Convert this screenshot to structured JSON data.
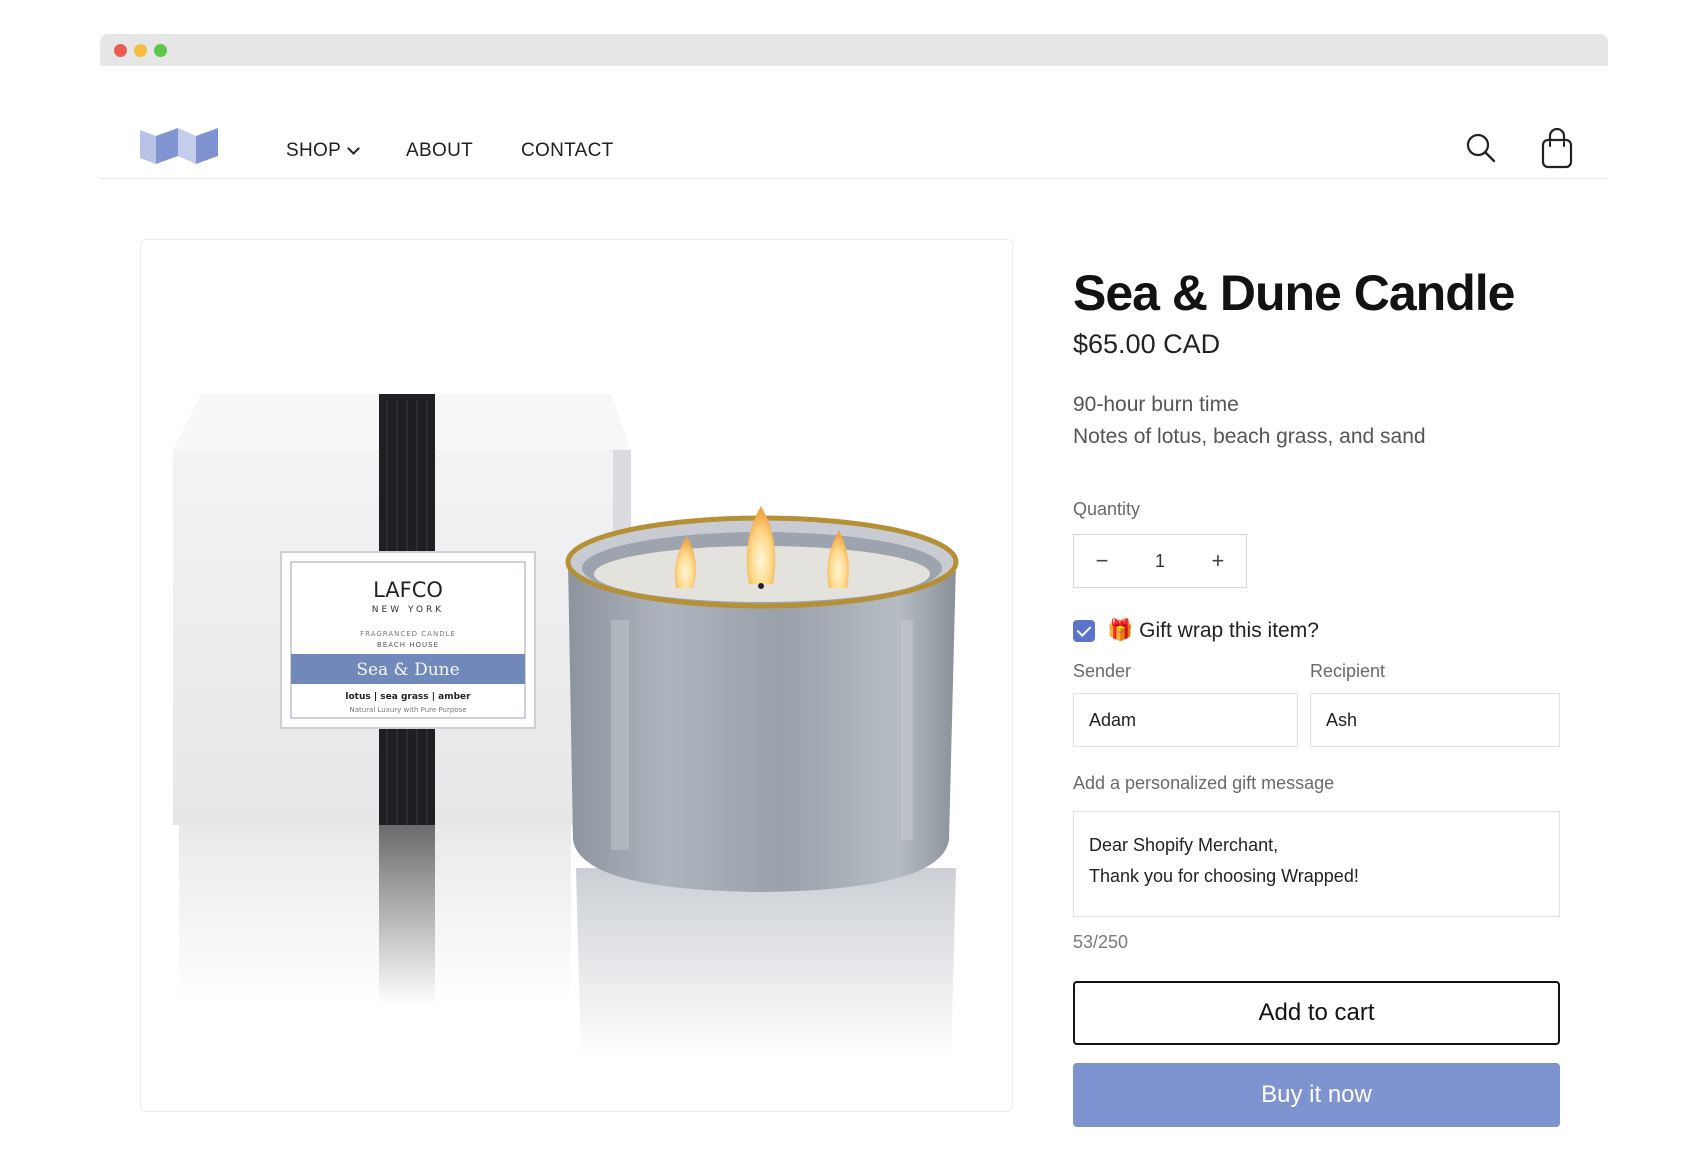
{
  "window": {
    "traffic_lights": [
      "red",
      "yellow",
      "green"
    ]
  },
  "header": {
    "logo_icon": "folded-paper-logo-icon",
    "nav": [
      {
        "label": "SHOP",
        "has_dropdown": true
      },
      {
        "label": "ABOUT"
      },
      {
        "label": "CONTACT"
      }
    ],
    "icons": [
      "search-icon",
      "cart-bag-icon"
    ]
  },
  "product": {
    "title": "Sea & Dune Candle",
    "price": "$65.00 CAD",
    "description": [
      "90-hour burn time",
      "Notes of lotus, beach grass, and sand"
    ],
    "image": {
      "brand": "LAFCO",
      "brand_sub": "NEW YORK",
      "label_line1": "FRAGRANCED CANDLE",
      "label_line2": "BEACH HOUSE",
      "label_name": "Sea & Dune",
      "label_notes": "lotus | sea grass | amber",
      "label_tagline": "Natural Luxury with Pure Purpose"
    },
    "quantity": {
      "label": "Quantity",
      "value": "1",
      "minus": "−",
      "plus": "+"
    },
    "gift_wrap": {
      "checked": true,
      "emoji": "🎁",
      "label": "Gift wrap this item?"
    },
    "sender": {
      "label": "Sender",
      "value": "Adam"
    },
    "recipient": {
      "label": "Recipient",
      "value": "Ash"
    },
    "message": {
      "label": "Add a personalized gift message",
      "line1": "Dear Shopify Merchant,",
      "line2": "Thank you for choosing Wrapped!",
      "counter": "53/250"
    },
    "add_to_cart": "Add to cart",
    "buy_now": "Buy it now"
  },
  "colors": {
    "accent": "#7f93d1",
    "checkbox": "#5b73c8",
    "label_band": "#7089ba"
  }
}
